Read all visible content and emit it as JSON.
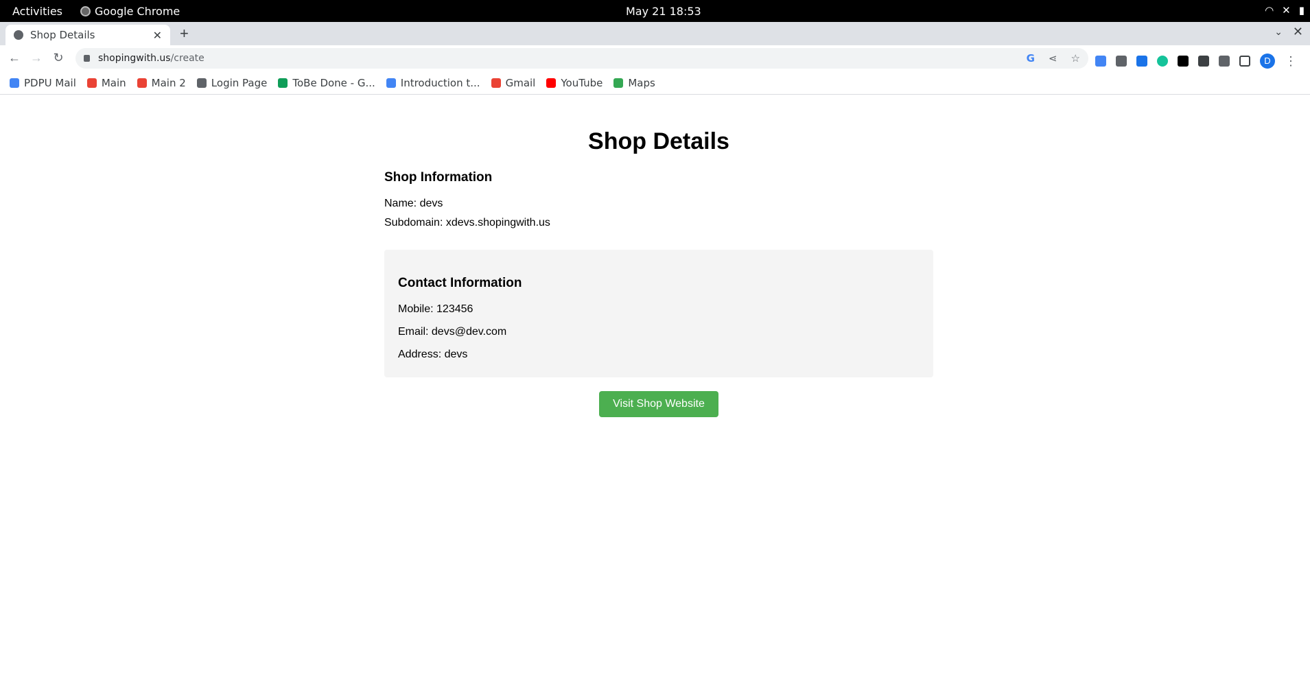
{
  "os": {
    "activities": "Activities",
    "app_name": "Google Chrome",
    "clock": "May 21  18:53"
  },
  "browser": {
    "tab_title": "Shop Details",
    "url_host": "shopingwith.us",
    "url_path": "/create",
    "profile_initial": "D",
    "bookmarks": [
      {
        "label": "PDPU Mail",
        "icon": "google-icon",
        "color": "#4285f4"
      },
      {
        "label": "Main",
        "icon": "gmail-icon",
        "color": "#ea4335"
      },
      {
        "label": "Main 2",
        "icon": "gmail-icon",
        "color": "#ea4335"
      },
      {
        "label": "Login Page",
        "icon": "globe-icon",
        "color": "#5f6368"
      },
      {
        "label": "ToBe Done - G...",
        "icon": "sheets-icon",
        "color": "#0f9d58"
      },
      {
        "label": "Introduction t...",
        "icon": "docs-icon",
        "color": "#4285f4"
      },
      {
        "label": "Gmail",
        "icon": "gmail-icon",
        "color": "#ea4335"
      },
      {
        "label": "YouTube",
        "icon": "youtube-icon",
        "color": "#ff0000"
      },
      {
        "label": "Maps",
        "icon": "maps-icon",
        "color": "#34a853"
      }
    ]
  },
  "page": {
    "title": "Shop Details",
    "shop_info": {
      "heading": "Shop Information",
      "name": "Name: devs",
      "subdomain": "Subdomain: xdevs.shopingwith.us"
    },
    "contact": {
      "heading": "Contact Information",
      "mobile": "Mobile: 123456",
      "email": "Email: devs@dev.com",
      "address": "Address: devs"
    },
    "visit_button": "Visit Shop Website",
    "accent_color": "#4caf50"
  }
}
